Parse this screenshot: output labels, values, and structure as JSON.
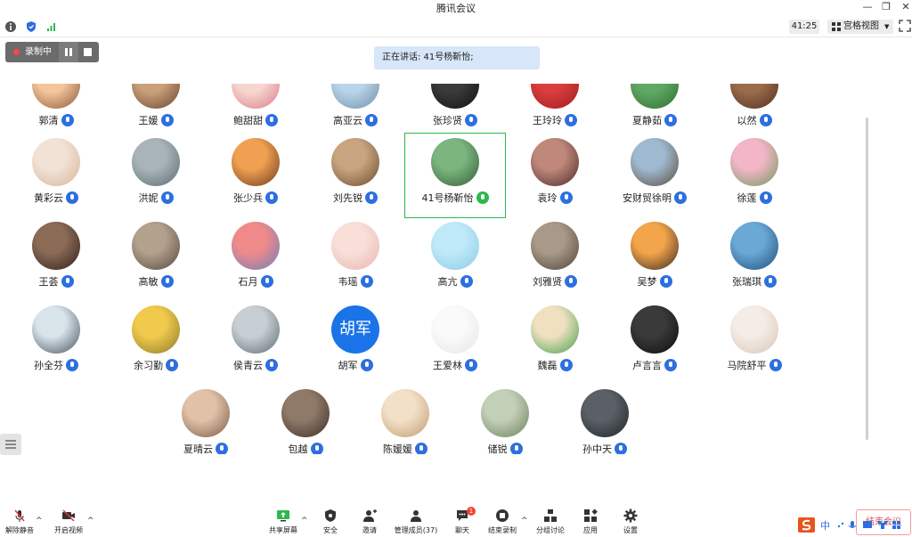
{
  "window": {
    "title": "腾讯会议",
    "minimize": "—",
    "restore": "❐",
    "close": "✕"
  },
  "toolbar": {
    "timer": "41:25",
    "view_mode": "宫格视图",
    "view_caret": "▼"
  },
  "recording": {
    "label": "录制中"
  },
  "speaking": {
    "label": "正在讲话: 41号杨靳怡;"
  },
  "participants": [
    {
      "name": "郭清"
    },
    {
      "name": "王媛"
    },
    {
      "name": "鲍甜甜"
    },
    {
      "name": "高亚云"
    },
    {
      "name": "张珍贤"
    },
    {
      "name": "王玲玲"
    },
    {
      "name": "夏静茹"
    },
    {
      "name": "以然"
    },
    {
      "name": "黄彩云"
    },
    {
      "name": "洪妮"
    },
    {
      "name": "张少兵"
    },
    {
      "name": "刘先锐"
    },
    {
      "name": "41号杨靳怡"
    },
    {
      "name": "袁玲"
    },
    {
      "name": "安财贸徐明"
    },
    {
      "name": "徐莲"
    },
    {
      "name": "王荟"
    },
    {
      "name": "高敏"
    },
    {
      "name": "石月"
    },
    {
      "name": "韦瑶"
    },
    {
      "name": "高亢"
    },
    {
      "name": "刘雅贤"
    },
    {
      "name": "吴梦"
    },
    {
      "name": "张瑞琪"
    },
    {
      "name": "孙全芬"
    },
    {
      "name": "余习勤"
    },
    {
      "name": "侯青云"
    },
    {
      "name": "胡军",
      "avatar_text": "胡军"
    },
    {
      "name": "王爱林"
    },
    {
      "name": "魏磊"
    },
    {
      "name": "卢言言"
    },
    {
      "name": "马院舒平"
    },
    {
      "name": "夏晴云"
    },
    {
      "name": "包越"
    },
    {
      "name": "陈媛媛"
    },
    {
      "name": "储锐"
    },
    {
      "name": "孙中天"
    }
  ],
  "bottombar": {
    "unmute": "解除静音",
    "start_video": "开启视频",
    "share_screen": "共享屏幕",
    "security": "安全",
    "invite": "邀请",
    "manage_members": "管理成员(37)",
    "chat": "聊天",
    "chat_badge": "1",
    "end_recording": "结束录制",
    "breakout": "分组讨论",
    "apps": "应用",
    "settings": "设置",
    "end_meeting": "结束会议"
  },
  "ime": {
    "label": "中"
  },
  "colors": {
    "accent": "#2d6fe0",
    "active_border": "#2db84d",
    "speaking_bg": "#d7e6f8",
    "end_red": "#e24a4a"
  }
}
